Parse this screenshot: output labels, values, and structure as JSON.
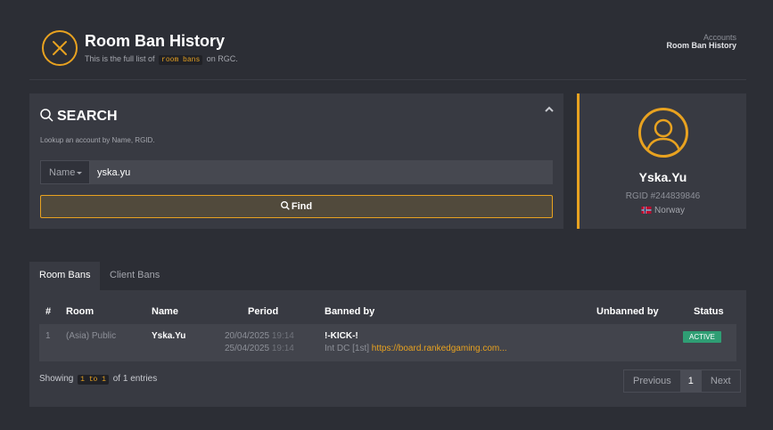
{
  "header": {
    "title": "Room Ban History",
    "subtitle_before": "This is the full list of",
    "subtitle_code": "room bans",
    "subtitle_after": "on RGC.",
    "breadcrumb_parent": "Accounts",
    "breadcrumb_current": "Room Ban History",
    "logo_icon": "ban-circle-icon",
    "accent_color": "#e8a220"
  },
  "search": {
    "title": "SEARCH",
    "hint": "Lookup an account by Name, RGID.",
    "field_select": "Name",
    "input_value": "yska.yu",
    "find_label": "Find",
    "search_icon": "magnifier-icon",
    "collapse_icon": "chevron-up-icon"
  },
  "profile": {
    "name": "Yska.Yu",
    "rgid": "RGID #244839846",
    "country": "Norway",
    "avatar_icon": "user-silhouette-icon",
    "flag_icon": "norway-flag-icon"
  },
  "tabs": [
    "Room Bans",
    "Client Bans"
  ],
  "table": {
    "headers": [
      "#",
      "Room",
      "Name",
      "Period",
      "Banned by",
      "Unbanned by",
      "Status"
    ],
    "rows": [
      {
        "index": "1",
        "room": "(Asia) Public",
        "name": "Yska.Yu",
        "start_date": "20/04/2025",
        "start_time": "19:14",
        "end_date": "25/04/2025",
        "end_time": "19:14",
        "banned_by": "!-KICK-!",
        "reason": "Int DC [1st]",
        "link": "https://board.rankedgaming.com...",
        "unbanned_by": "",
        "status": "ACTIVE"
      }
    ]
  },
  "footer": {
    "showing_prefix": "Showing",
    "showing_range": "1 to 1",
    "showing_suffix": "of 1 entries",
    "prev_label": "Previous",
    "page": "1",
    "next_label": "Next"
  }
}
